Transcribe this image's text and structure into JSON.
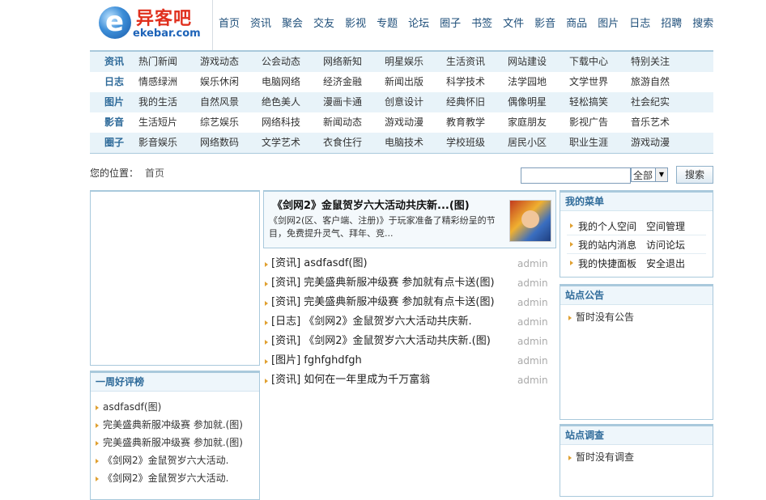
{
  "logo": {
    "cn": "异客吧",
    "en": "ekebar.com"
  },
  "topnav": [
    "首页",
    "资讯",
    "聚会",
    "交友",
    "影视",
    "专题",
    "论坛",
    "圈子",
    "书签",
    "文件",
    "影音",
    "商品",
    "图片",
    "日志",
    "招聘",
    "搜索"
  ],
  "categories": [
    {
      "head": "资讯",
      "items": [
        "热门新闻",
        "游戏动态",
        "公会动态",
        "网络新知",
        "明星娱乐",
        "生活资讯",
        "网站建设",
        "下载中心",
        "特别关注"
      ]
    },
    {
      "head": "日志",
      "items": [
        "情感绿洲",
        "娱乐休闲",
        "电脑网络",
        "经济金融",
        "新闻出版",
        "科学技术",
        "法学园地",
        "文学世界",
        "旅游自然"
      ]
    },
    {
      "head": "图片",
      "items": [
        "我的生活",
        "自然风景",
        "绝色美人",
        "漫画卡通",
        "创意设计",
        "经典怀旧",
        "偶像明星",
        "轻松搞笑",
        "社会纪实"
      ]
    },
    {
      "head": "影音",
      "items": [
        "生活短片",
        "综艺娱乐",
        "网络科技",
        "新闻动态",
        "游戏动漫",
        "教育教学",
        "家庭朋友",
        "影视广告",
        "音乐艺术"
      ]
    },
    {
      "head": "圈子",
      "items": [
        "影音娱乐",
        "网络数码",
        "文学艺术",
        "衣食住行",
        "电脑技术",
        "学校班级",
        "居民小区",
        "职业生涯",
        "游戏动漫"
      ]
    }
  ],
  "location": {
    "label": "您的位置：",
    "crumb": "首页"
  },
  "search": {
    "placeholder": "",
    "select_value": "全部",
    "button": "搜索"
  },
  "week_box": {
    "title": "一周好评榜",
    "items": [
      "asdfasdf(图)",
      "完美盛典新服冲级赛 参加就.(图)",
      "完美盛典新服冲级赛 参加就.(图)",
      "《剑网2》金鼠贺岁六大活动.",
      "《剑网2》金鼠贺岁六大活动."
    ]
  },
  "feature": {
    "title": "《剑网2》金鼠贺岁六大活动共庆新...(图)",
    "desc": "《剑网2(区、客户端、注册)》于玩家准备了精彩纷呈的节目，免费提升灵气、拜年、竞..."
  },
  "news": [
    {
      "title": "[资讯] asdfasdf(图)",
      "author": "admin"
    },
    {
      "title": "[资讯] 完美盛典新服冲级赛 参加就有点卡送(图)",
      "author": "admin"
    },
    {
      "title": "[资讯] 完美盛典新服冲级赛 参加就有点卡送(图)",
      "author": "admin"
    },
    {
      "title": "[日志] 《剑网2》金鼠贺岁六大活动共庆新.",
      "author": "admin"
    },
    {
      "title": "[资讯] 《剑网2》金鼠贺岁六大活动共庆新.(图)",
      "author": "admin"
    },
    {
      "title": "[图片] fghfghdfgh",
      "author": "admin"
    },
    {
      "title": "[资讯] 如何在一年里成为千万富翁",
      "author": "admin"
    }
  ],
  "menu": {
    "title": "我的菜单",
    "rows": [
      [
        "我的个人空间",
        "空间管理"
      ],
      [
        "我的站内消息",
        "访问论坛"
      ],
      [
        "我的快捷面板",
        "安全退出"
      ]
    ]
  },
  "notice": {
    "title": "站点公告",
    "text": "暂时没有公告"
  },
  "survey": {
    "title": "站点调查",
    "text": "暂时没有调查"
  },
  "colors": {
    "accent": "#2f6b9a",
    "border": "#a9c9dc",
    "row_alt": "#e8f3f9",
    "arrow": "#e0a030"
  }
}
